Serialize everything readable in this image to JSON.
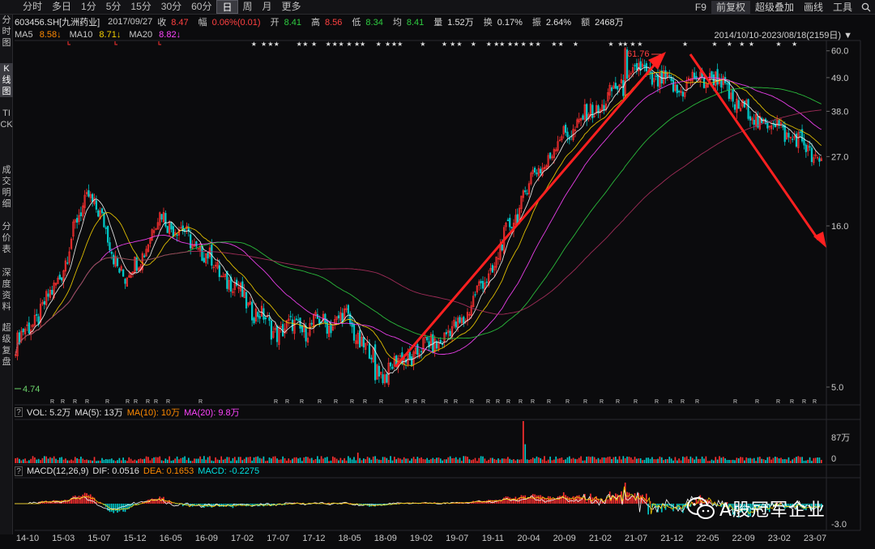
{
  "toolbar": {
    "periods": [
      "分时",
      "多日",
      "1分",
      "5分",
      "15分",
      "30分",
      "60分",
      "日",
      "周",
      "月",
      "更多"
    ],
    "active_period": "日",
    "right": [
      "F9",
      "前复权",
      "超级叠加",
      "画线",
      "工具"
    ]
  },
  "sidebar": {
    "tabs": [
      "分时图",
      "K线图",
      "TICK",
      "成交明细",
      "分价表",
      "深度资料",
      "超级复盘"
    ],
    "active": "K线图"
  },
  "quote": {
    "code": "603456.SH[九洲药业]",
    "date": "2017/09/27",
    "close_label": "收",
    "close": "8.47",
    "change_label": "幅",
    "change": "0.06%(0.01)",
    "open_label": "开",
    "open": "8.41",
    "high_label": "高",
    "high": "8.56",
    "low_label": "低",
    "low": "8.34",
    "avg_label": "均",
    "avg": "8.41",
    "vol_label": "量",
    "vol": "1.52万",
    "turnover_label": "换",
    "turnover": "0.17%",
    "amp_label": "振",
    "amp": "2.64%",
    "amount_label": "额",
    "amount": "2468万"
  },
  "ma": {
    "ma5_label": "MA5",
    "ma5": "8.58↓",
    "ma10_label": "MA10",
    "ma10": "8.71↓",
    "ma20_label": "MA20",
    "ma20": "8.82↓"
  },
  "date_range": "2014/10/10-2023/08/18(2159日)",
  "volume_panel": {
    "label": "VOL: 5.2万",
    "ma5": "MA(5): 13万",
    "ma10": "MA(10): 10万",
    "ma20": "MA(20): 9.8万",
    "axis": [
      "87万",
      "0"
    ]
  },
  "macd_panel": {
    "label": "MACD(12,26,9)",
    "dif": "DIF: 0.0516",
    "dea": "DEA: 0.1653",
    "macd": "MACD: -0.2275",
    "axis": [
      "-3.0"
    ]
  },
  "price_axis": [
    "60.0",
    "49.0",
    "38.0",
    "27.0",
    "16.0",
    "5.0"
  ],
  "annotations": {
    "high": "61.76",
    "low": "4.74"
  },
  "x_axis": [
    "14-10",
    "15-03",
    "15-07",
    "15-12",
    "16-05",
    "16-09",
    "17-02",
    "17-07",
    "17-12",
    "18-05",
    "18-09",
    "19-02",
    "19-07",
    "19-11",
    "20-04",
    "20-09",
    "21-02",
    "21-07",
    "21-12",
    "22-05",
    "22-09",
    "23-02",
    "23-07"
  ],
  "watermark": "A股冠军企业",
  "colors": {
    "up": "#ff3030",
    "down": "#00d0d0",
    "ma5": "#f5f5f5",
    "ma10": "#f5d000",
    "ma20": "#ff44ff",
    "bg": "#0b0b0d"
  },
  "chart_data": {
    "type": "line",
    "price_scale": "log",
    "ylim": [
      4.74,
      61.76
    ],
    "x": [
      "14-10",
      "15-03",
      "15-07",
      "15-12",
      "16-05",
      "16-09",
      "17-02",
      "17-07",
      "17-12",
      "18-05",
      "18-09",
      "19-02",
      "19-07",
      "19-11",
      "20-04",
      "20-09",
      "21-02",
      "21-07",
      "21-12",
      "22-05",
      "22-09",
      "23-02",
      "23-07"
    ],
    "series": [
      {
        "values": [
          6.5,
          9.5,
          21.0,
          10.5,
          17.5,
          13.5,
          10.0,
          7.3,
          7.5,
          8.0,
          5.3,
          6.2,
          7.3,
          11.5,
          22.0,
          32.0,
          40.0,
          52.0,
          45.0,
          50.0,
          37.0,
          33.0,
          26.0
        ]
      }
    ]
  }
}
